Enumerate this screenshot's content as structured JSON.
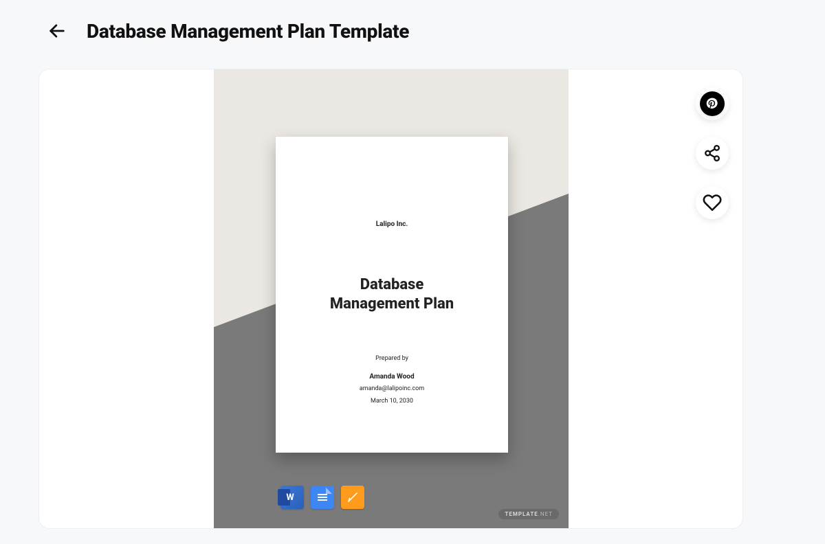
{
  "header": {
    "title": "Database Management Plan Template"
  },
  "preview": {
    "company": "Lalipo Inc.",
    "title_line1": "Database",
    "title_line2": "Management Plan",
    "prepared_label": "Prepared by",
    "prepared_name": "Amanda Wood",
    "prepared_email": "amanda@lalipoinc.com",
    "prepared_date": "March 10, 2030",
    "watermark_brand": "TEMPLATE",
    "watermark_suffix": ".NET"
  },
  "formats": {
    "word": "W"
  },
  "actions": {
    "pinterest": "pinterest-icon",
    "share": "share-icon",
    "favorite": "heart-icon"
  }
}
